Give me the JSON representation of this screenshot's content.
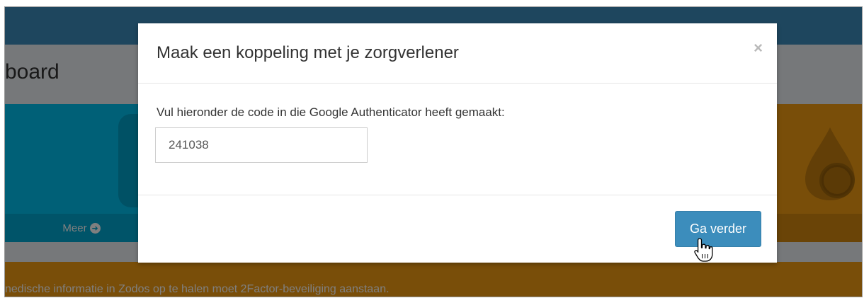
{
  "background": {
    "page_title": "board",
    "info_box_footer_label": "Meer",
    "callout_text": "nedische informatie in Zodos op te halen moet 2Factor-beveiliging aanstaan."
  },
  "modal": {
    "title": "Maak een koppeling met je zorgverlener",
    "close_symbol": "×",
    "field_label": "Vul hieronder de code in die Google Authenticator heeft gemaakt:",
    "code_value": "241038",
    "next_button_label": "Ga verder"
  },
  "colors": {
    "topbar": "#3c8dbc",
    "info_blue": "#00c0ef",
    "warning_orange": "#f39c12",
    "primary_button": "#3c8dbc"
  },
  "icons": {
    "footer_arrow": "circle-arrow-right-icon",
    "box_icon": "drop-icon",
    "cursor": "hand-pointer-icon"
  }
}
